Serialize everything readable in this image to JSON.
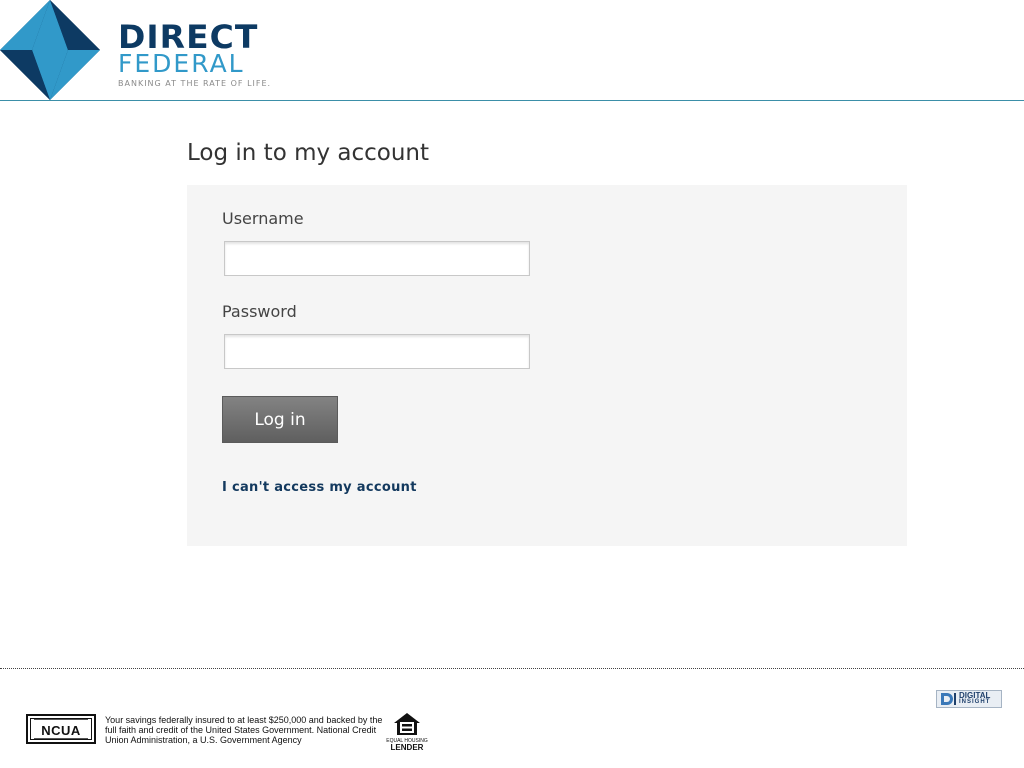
{
  "brand": {
    "name_line1": "DIRECT",
    "name_line2": "FEDERAL",
    "tagline": "BANKING AT THE RATE OF LIFE.",
    "colors": {
      "navy": "#0d3a63",
      "sky": "#3199c9"
    }
  },
  "main": {
    "title": "Log in to my account",
    "username_label": "Username",
    "username_value": "",
    "password_label": "Password",
    "password_value": "",
    "login_button": "Log in",
    "help_link": "I can't access my account"
  },
  "footer": {
    "ncua_logo": "NCUA",
    "ncua_statement": "Your savings federally insured to at least $250,000 and backed by the full faith and credit of the United States Government. National Credit Union Administration, a U.S. Government Agency",
    "eho_line1": "EQUAL HOUSING",
    "eho_line2": "LENDER",
    "badge_line1": "DIGITAL",
    "badge_line2": "INSIGHT",
    "icons": [
      "direct-federal-diamond-icon",
      "equal-housing-icon",
      "digital-insight-d-icon"
    ]
  }
}
